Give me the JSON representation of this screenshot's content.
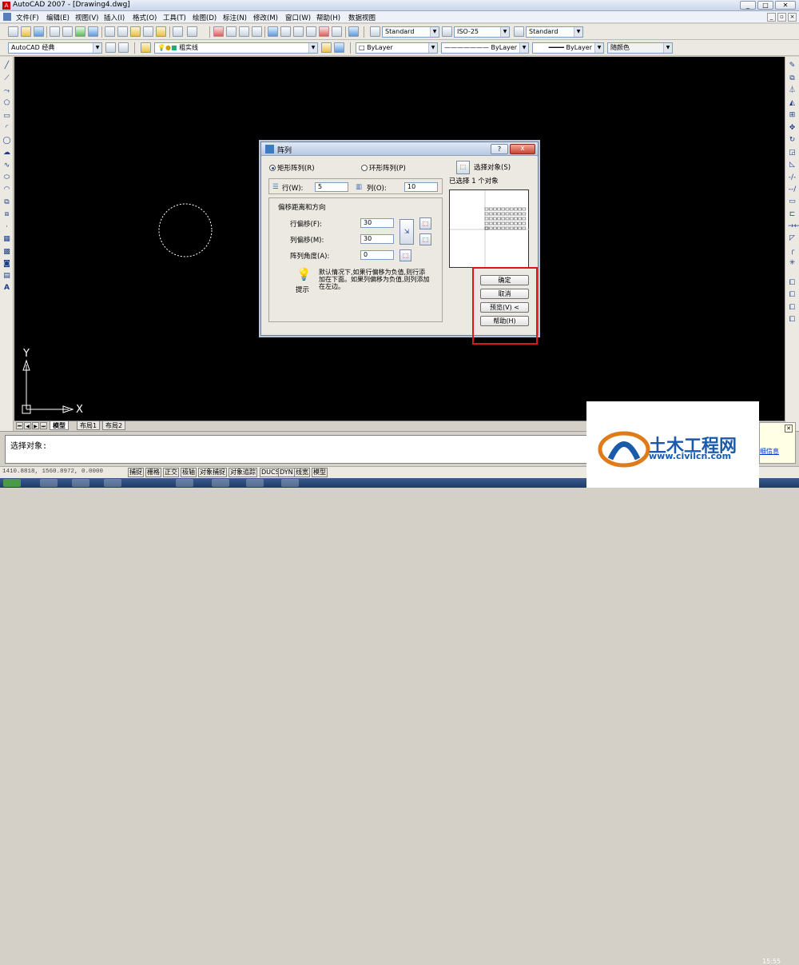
{
  "window": {
    "title": "AutoCAD 2007 - [Drawing4.dwg]"
  },
  "menu": [
    "文件(F)",
    "编辑(E)",
    "视图(V)",
    "插入(I)",
    "格式(O)",
    "工具(T)",
    "绘图(D)",
    "标注(N)",
    "修改(M)",
    "窗口(W)",
    "帮助(H)",
    "数据视图"
  ],
  "toolbar": {
    "text_style": "Standard",
    "dim_style": "ISO-25",
    "table_style": "Standard",
    "workspace": "AutoCAD 经典",
    "layer": "粗实线",
    "color": "ByLayer",
    "linetype": "ByLayer",
    "lineweight": "ByLayer",
    "plot_style": "随颜色"
  },
  "canvas": {
    "axis_x": "X",
    "axis_y": "Y"
  },
  "layout_tabs": [
    "模型",
    "布局1",
    "布局2"
  ],
  "command": {
    "prompt": "选择对象:"
  },
  "status": {
    "coords": "1410.8818,  1560.8972,  0.0000",
    "buttons": [
      "捕捉",
      "栅格",
      "正交",
      "极轴",
      "对象捕捉",
      "对象追踪",
      "DUCS",
      "DYN",
      "线宽",
      "模型"
    ]
  },
  "dialog": {
    "title": "阵列",
    "help": "?",
    "close": "x",
    "rect_array": "矩形阵列(R)",
    "polar_array": "环形阵列(P)",
    "select_objects": "选择对象(S)",
    "selected_count": "已选择 1 个对象",
    "rows_label": "行(W):",
    "rows_value": "5",
    "cols_label": "列(O):",
    "cols_value": "10",
    "offset_group": "偏移距离和方向",
    "row_offset_label": "行偏移(F):",
    "row_offset_value": "30",
    "col_offset_label": "列偏移(M):",
    "col_offset_value": "30",
    "angle_label": "阵列角度(A):",
    "angle_value": "0",
    "hint_text": "默认情况下,如果行偏移为负值,则行添加在下面。如果列偏移为负值,则列添加在左边。",
    "hint_label": "提示",
    "ok": "确定",
    "cancel": "取消",
    "preview": "预览(V) <",
    "helpbtn": "帮助(H)"
  },
  "watermark": {
    "name": "土木工程网",
    "url": "www.civilcn.com"
  },
  "balloon": {
    "link": "细信息"
  },
  "clock": "15:55"
}
